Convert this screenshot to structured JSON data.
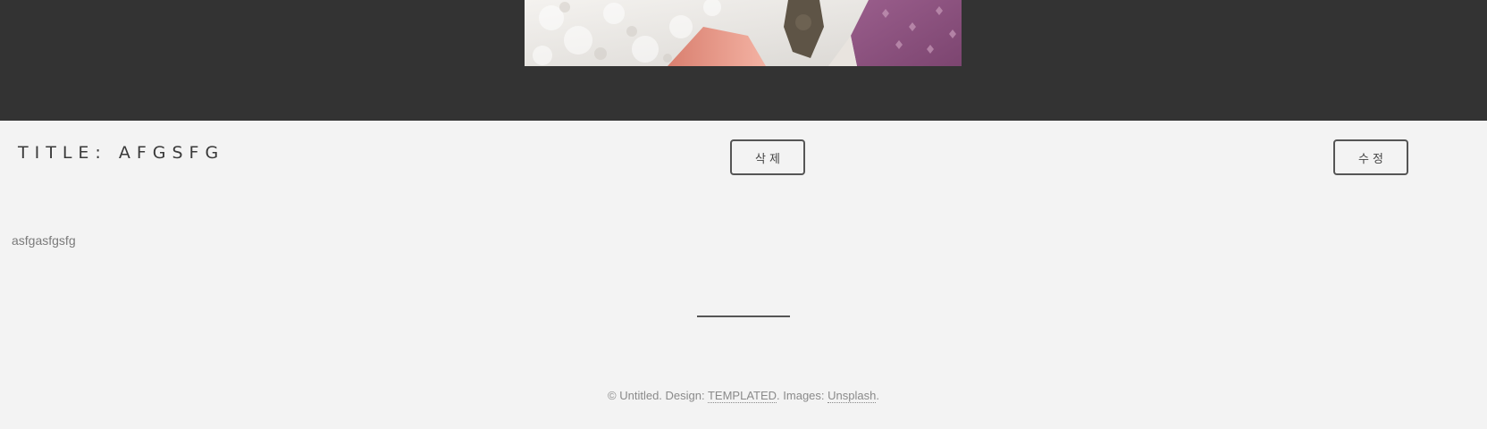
{
  "post": {
    "title": "TITLE: AFGSFG",
    "body": "asfgasfgsfg"
  },
  "actions": {
    "delete_label": "삭제",
    "edit_label": "수정"
  },
  "footer": {
    "copyright": "© Untitled. Design: ",
    "design_link": "TEMPLATED",
    "images_prefix": ". Images: ",
    "images_link": "Unsplash",
    "suffix": "."
  },
  "colors": {
    "header_band": "#333333",
    "page_background": "#f3f3f3",
    "button_border": "#555555"
  }
}
